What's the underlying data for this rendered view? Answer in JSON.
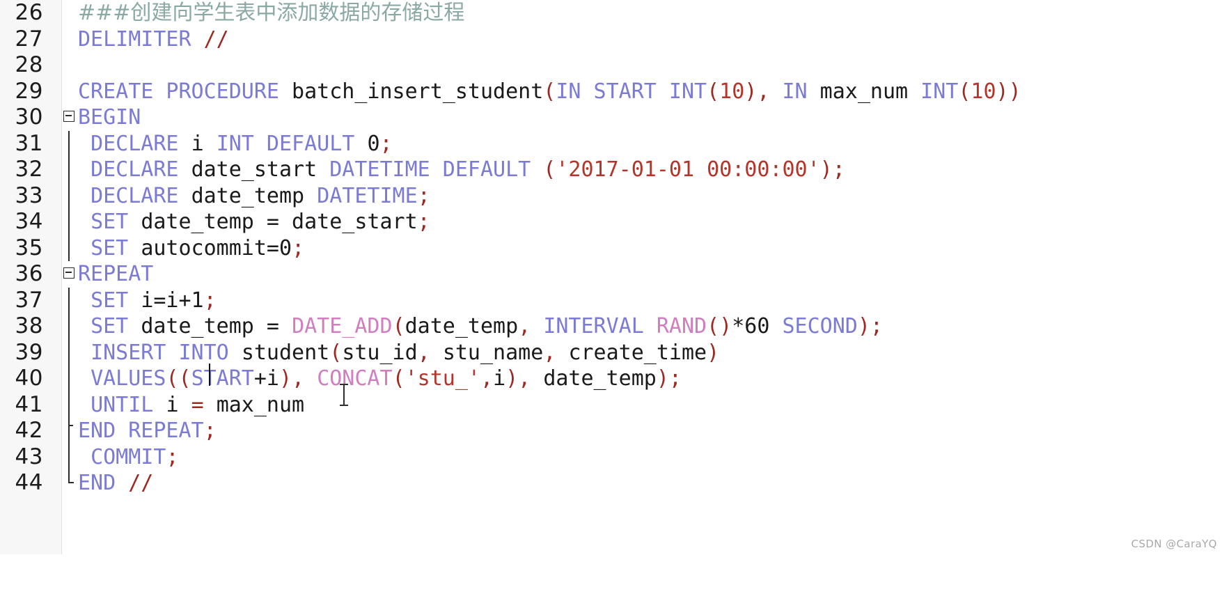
{
  "editor": {
    "language": "SQL",
    "first_line_number": 26,
    "colors": {
      "background": "#ffffff",
      "gutter_background": "#f7f7f7",
      "keyword": "#7b7bd4",
      "function": "#d07ec0",
      "string": "#b4342a",
      "punctuation": "#9c2a22",
      "comment": "#8aa9a4",
      "plain_text": "#1a1a1a",
      "line_number": "#1c1c1c"
    },
    "line_numbers": [
      "26",
      "27",
      "28",
      "29",
      "30",
      "31",
      "32",
      "33",
      "34",
      "35",
      "36",
      "37",
      "38",
      "39",
      "40",
      "41",
      "42",
      "43",
      "44"
    ],
    "lines": [
      {
        "n": "26",
        "fold": "none",
        "text": "###创建向学生表中添加数据的存储过程"
      },
      {
        "n": "27",
        "fold": "none",
        "text": "DELIMITER //"
      },
      {
        "n": "28",
        "fold": "none",
        "text": ""
      },
      {
        "n": "29",
        "fold": "none",
        "text": "CREATE PROCEDURE batch_insert_student(IN START INT(10), IN max_num INT(10))"
      },
      {
        "n": "30",
        "fold": "open",
        "text": "BEGIN"
      },
      {
        "n": "31",
        "fold": "guide",
        "text": "DECLARE i INT DEFAULT 0;"
      },
      {
        "n": "32",
        "fold": "guide",
        "text": "DECLARE date_start DATETIME DEFAULT ('2017-01-01 00:00:00');"
      },
      {
        "n": "33",
        "fold": "guide",
        "text": "DECLARE date_temp DATETIME;"
      },
      {
        "n": "34",
        "fold": "guide",
        "text": "SET date_temp = date_start;"
      },
      {
        "n": "35",
        "fold": "guide",
        "text": "SET autocommit=0;"
      },
      {
        "n": "36",
        "fold": "open",
        "text": "REPEAT"
      },
      {
        "n": "37",
        "fold": "guide",
        "text": "SET i=i+1;"
      },
      {
        "n": "38",
        "fold": "guide",
        "text": "SET date_temp = DATE_ADD(date_temp, INTERVAL RAND()*60 SECOND);"
      },
      {
        "n": "39",
        "fold": "guide",
        "text": "INSERT INTO student(stu_id, stu_name, create_time)"
      },
      {
        "n": "40",
        "fold": "guide",
        "text": "VALUES((START+i), CONCAT('stu_',i), date_temp);"
      },
      {
        "n": "41",
        "fold": "guide",
        "text": "UNTIL i = max_num"
      },
      {
        "n": "42",
        "fold": "tick",
        "text": "END REPEAT;"
      },
      {
        "n": "43",
        "fold": "guide",
        "text": "COMMIT;"
      },
      {
        "n": "44",
        "fold": "end",
        "text": "END //"
      }
    ]
  },
  "caret": {
    "line": "40",
    "token": "START",
    "label": "text-cursor"
  },
  "mouse": {
    "label": "i-beam-pointer"
  },
  "watermark": {
    "text": "CSDN @CaraYQ"
  }
}
